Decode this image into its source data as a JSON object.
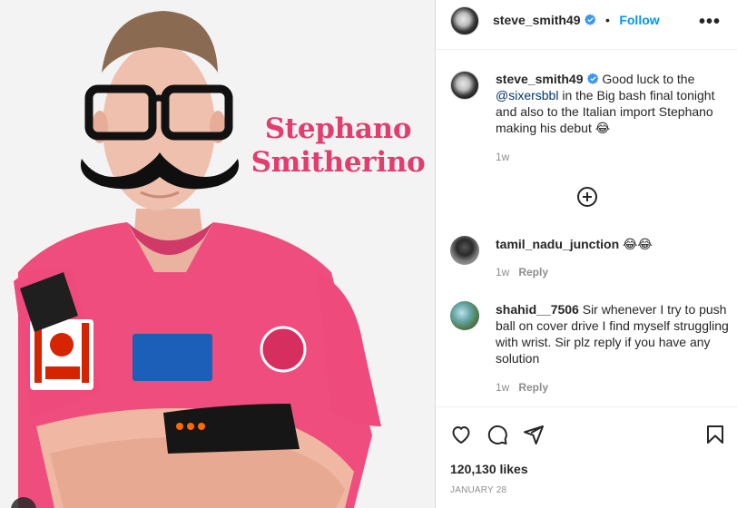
{
  "post": {
    "username": "steve_smith49",
    "follow_label": "Follow",
    "separator": "•",
    "more_label": "•••",
    "image_text": [
      "Stephano",
      "Smitherino"
    ]
  },
  "caption": {
    "username": "steve_smith49",
    "text_before": "Good luck to the ",
    "mention": "@sixersbbl",
    "text_after": " in the Big bash final tonight and also to the Italian import Stephano making his debut 😂",
    "time": "1w"
  },
  "comments": [
    {
      "username": "tamil_nadu_junction",
      "text": "😂😂",
      "time": "1w",
      "reply_label": "Reply"
    },
    {
      "username": "shahid__7506",
      "text": "Sir whenever I try to push ball on cover drive I find myself struggling with wrist. Sir plz reply if you have any solution",
      "time": "1w",
      "reply_label": "Reply"
    }
  ],
  "likes_text": "120,130 likes",
  "date_text": "January 28",
  "colors": {
    "accent": "#0095f6",
    "verified": "#3897f0",
    "mention": "#00376b",
    "overlay_text": "#e23d6d",
    "jersey": "#ef4d7e"
  },
  "icons": [
    "verified-icon",
    "more-options-icon",
    "load-more-comments-icon",
    "heart-icon",
    "comment-icon",
    "share-icon",
    "bookmark-icon"
  ]
}
